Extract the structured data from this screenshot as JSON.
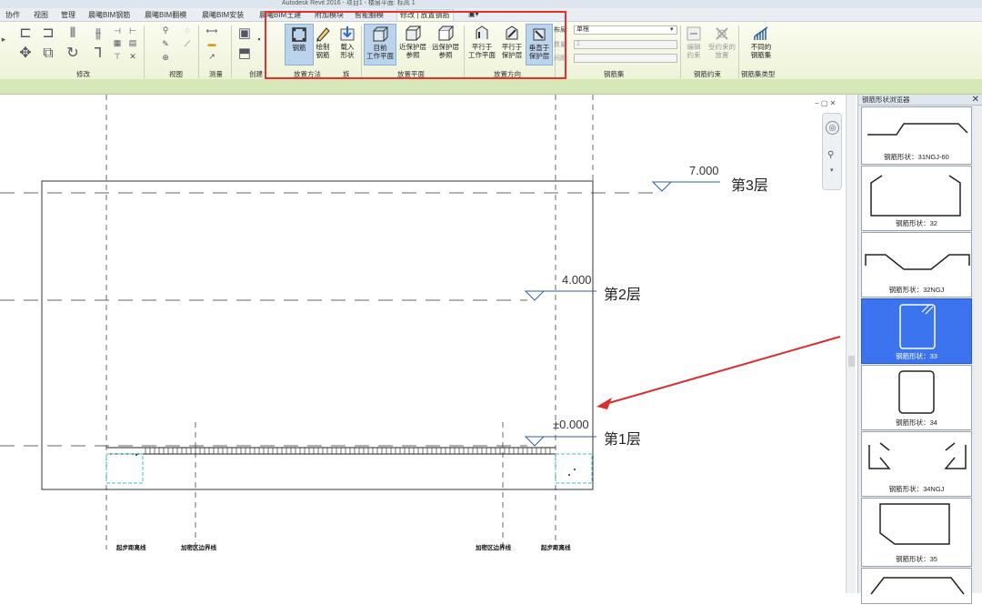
{
  "titlebar": {
    "center_text": "Autodesk Revit 2016  -  项目1 - 楼层平面: 标高 1"
  },
  "tabs": [
    {
      "label": "协作"
    },
    {
      "label": "视图"
    },
    {
      "label": "管理"
    },
    {
      "label": "晨曦BIM钢筋"
    },
    {
      "label": "晨曦BIM翻模"
    },
    {
      "label": "晨曦BIM安装"
    },
    {
      "label": "晨曦BIM土建"
    },
    {
      "label": "附加模块"
    },
    {
      "label": "智能翻模"
    },
    {
      "label": "修改 | 放置钢筋"
    }
  ],
  "ribbon": {
    "panels": {
      "modify": "修改",
      "view": "视图",
      "measure": "测量",
      "create": "创建",
      "placement_method": "放置方法",
      "family": "族",
      "placement_plane": "放置平面",
      "placement_orientation": "放置方向",
      "rebar_set": "钢筋集",
      "rebar_constraints": "钢筋约束",
      "rebar_set_type": "钢筋集类型"
    },
    "buttons": {
      "rebar": "钢筋",
      "sketch_rebar_1": "绘制",
      "sketch_rebar_2": "钢筋",
      "load_shape_1": "载入",
      "load_shape_2": "形状",
      "current_work_plane_1": "目前",
      "current_work_plane_2": "工作平面",
      "near_cover_1": "近保护层",
      "near_cover_2": "参照",
      "far_cover_1": "远保护层",
      "far_cover_2": "参照",
      "parallel_work_plane_1": "平行于",
      "parallel_work_plane_2": "工作平面",
      "parallel_cover_1": "平行于",
      "parallel_cover_2": "保护层",
      "perpendicular_cover_1": "垂直于",
      "perpendicular_cover_2": "保护层",
      "edit_constraints_1": "编辑",
      "edit_constraints_2": "约束",
      "affected_placement_1": "受约束的",
      "affected_placement_2": "放置",
      "different_set_1": "不同的",
      "different_set_2": "钢筋集"
    },
    "rebar_set_fields": {
      "layout_label": "布局:",
      "layout_value": "单根",
      "quantity_label": "数量:",
      "quantity_value": "1",
      "spacing_label": "间距:"
    }
  },
  "canvas": {
    "levels": [
      {
        "name": "第3层",
        "elevation": "7.000"
      },
      {
        "name": "第2层",
        "elevation": "4.000"
      },
      {
        "name": "第1层",
        "elevation": "±0.000"
      }
    ],
    "bottom_labels": [
      "起步距离线",
      "加密区边界线",
      "加密区边界线",
      "起步距离线"
    ]
  },
  "shape_browser": {
    "title": "钢筋形状浏览器",
    "items": [
      {
        "label": "钢筋形状：31NGJ-60",
        "selected": false
      },
      {
        "label": "钢筋形状：32",
        "selected": false
      },
      {
        "label": "钢筋形状：32NGJ",
        "selected": false
      },
      {
        "label": "钢筋形状：33",
        "selected": true
      },
      {
        "label": "钢筋形状：34",
        "selected": false
      },
      {
        "label": "钢筋形状：34NGJ",
        "selected": false
      },
      {
        "label": "钢筋形状：35",
        "selected": false
      }
    ]
  },
  "colors": {
    "selected": "#3c74f0",
    "annotation_red": "#e53030",
    "level_blue": "#2f5fa0",
    "rebar_cyan": "#39c6c8"
  }
}
